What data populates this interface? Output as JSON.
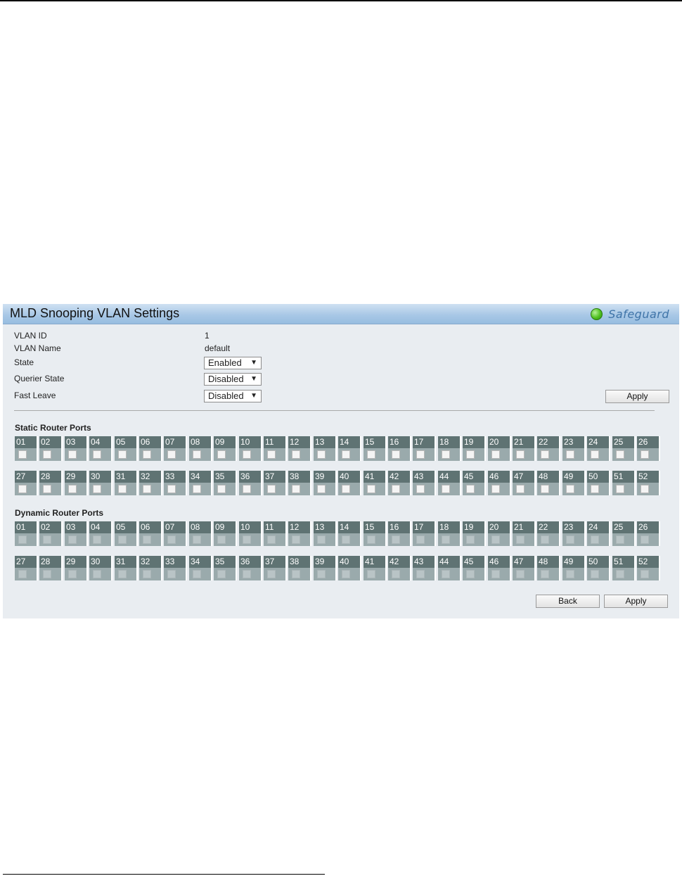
{
  "panel": {
    "title": "MLD Snooping VLAN Settings",
    "safeguard_label": "Safeguard",
    "accent_color": "#97bde0"
  },
  "fields": {
    "vlan_id_label": "VLAN ID",
    "vlan_id_value": "1",
    "vlan_name_label": "VLAN Name",
    "vlan_name_value": "default",
    "state_label": "State",
    "state_value": "Enabled",
    "querier_label": "Querier State",
    "querier_value": "Disabled",
    "fast_leave_label": "Fast Leave",
    "fast_leave_value": "Disabled"
  },
  "buttons": {
    "apply_top": "Apply",
    "back": "Back",
    "apply_bottom": "Apply"
  },
  "static_router_ports": {
    "title": "Static Router Ports",
    "row1": [
      "01",
      "02",
      "03",
      "04",
      "05",
      "06",
      "07",
      "08",
      "09",
      "10",
      "11",
      "12",
      "13",
      "14",
      "15",
      "16",
      "17",
      "18",
      "19",
      "20",
      "21",
      "22",
      "23",
      "24",
      "25",
      "26"
    ],
    "row2": [
      "27",
      "28",
      "29",
      "30",
      "31",
      "32",
      "33",
      "34",
      "35",
      "36",
      "37",
      "38",
      "39",
      "40",
      "41",
      "42",
      "43",
      "44",
      "45",
      "46",
      "47",
      "48",
      "49",
      "50",
      "51",
      "52"
    ]
  },
  "dynamic_router_ports": {
    "title": "Dynamic Router Ports",
    "row1": [
      "01",
      "02",
      "03",
      "04",
      "05",
      "06",
      "07",
      "08",
      "09",
      "10",
      "11",
      "12",
      "13",
      "14",
      "15",
      "16",
      "17",
      "18",
      "19",
      "20",
      "21",
      "22",
      "23",
      "24",
      "25",
      "26"
    ],
    "row2": [
      "27",
      "28",
      "29",
      "30",
      "31",
      "32",
      "33",
      "34",
      "35",
      "36",
      "37",
      "38",
      "39",
      "40",
      "41",
      "42",
      "43",
      "44",
      "45",
      "46",
      "47",
      "48",
      "49",
      "50",
      "51",
      "52"
    ]
  }
}
